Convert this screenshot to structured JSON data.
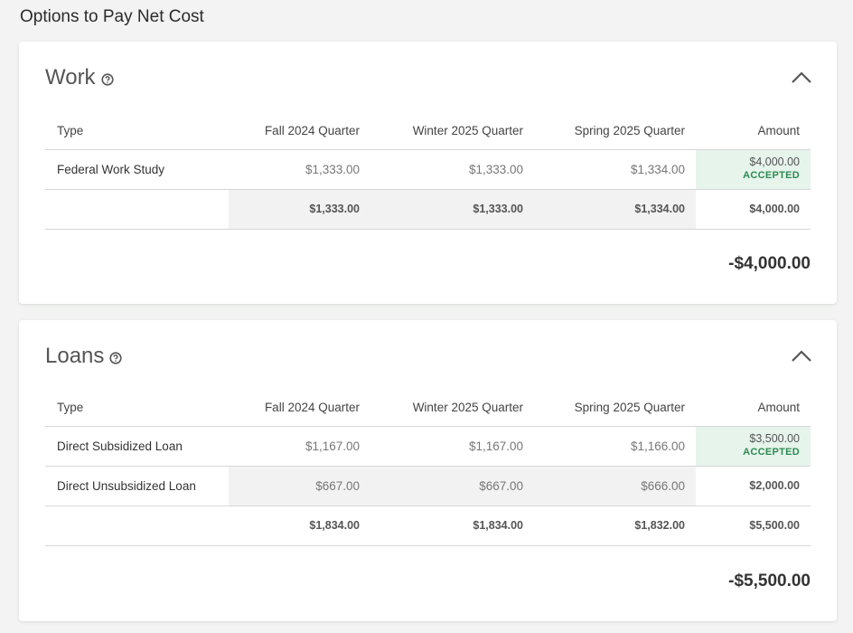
{
  "page": {
    "title": "Options to Pay Net Cost"
  },
  "columns": {
    "type": "Type",
    "q1": "Fall 2024 Quarter",
    "q2": "Winter 2025 Quarter",
    "q3": "Spring 2025 Quarter",
    "amount": "Amount"
  },
  "work": {
    "title": "Work",
    "rows": [
      {
        "type": "Federal Work Study",
        "q1": "$1,333.00",
        "q2": "$1,333.00",
        "q3": "$1,334.00",
        "amount": "$4,000.00",
        "status": "ACCEPTED"
      }
    ],
    "totals": {
      "q1": "$1,333.00",
      "q2": "$1,333.00",
      "q3": "$1,334.00",
      "amount": "$4,000.00"
    },
    "net": "-$4,000.00"
  },
  "loans": {
    "title": "Loans",
    "rows": [
      {
        "type": "Direct Subsidized Loan",
        "q1": "$1,167.00",
        "q2": "$1,167.00",
        "q3": "$1,166.00",
        "amount": "$3,500.00",
        "status": "ACCEPTED"
      },
      {
        "type": "Direct Unsubsidized Loan",
        "q1": "$667.00",
        "q2": "$667.00",
        "q3": "$666.00",
        "amount": "$2,000.00"
      }
    ],
    "totals": {
      "q1": "$1,834.00",
      "q2": "$1,834.00",
      "q3": "$1,832.00",
      "amount": "$5,500.00"
    },
    "net": "-$5,500.00"
  },
  "colors": {
    "accepted_bg": "#e6f4ec",
    "accepted_text": "#2e8a52",
    "shaded_bg": "#f2f2f2"
  },
  "icons": {
    "help": "question-circle",
    "collapse": "chevron-up"
  }
}
